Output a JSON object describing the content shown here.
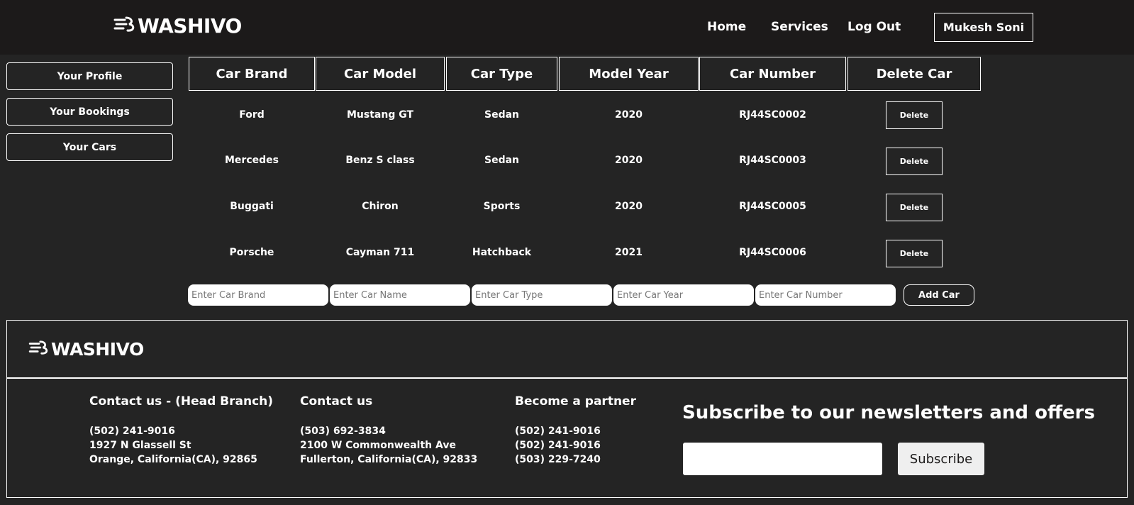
{
  "header": {
    "logo": "WASHIVO",
    "nav": [
      "Home",
      "Services",
      "Log Out"
    ],
    "user": "Mukesh Soni"
  },
  "sidebar": {
    "items": [
      "Your Profile",
      "Your Bookings",
      "Your Cars"
    ]
  },
  "table": {
    "columns": [
      "Car Brand",
      "Car Model",
      "Car Type",
      "Model Year",
      "Car Number",
      "Delete Car"
    ],
    "rows": [
      {
        "brand": "Ford",
        "model": "Mustang GT",
        "type": "Sedan",
        "year": "2020",
        "number": "RJ44SC0002",
        "action": "Delete"
      },
      {
        "brand": "Mercedes",
        "model": "Benz S class",
        "type": "Sedan",
        "year": "2020",
        "number": "RJ44SC0003",
        "action": "Delete"
      },
      {
        "brand": "Buggati",
        "model": "Chiron",
        "type": "Sports",
        "year": "2020",
        "number": "RJ44SC0005",
        "action": "Delete"
      },
      {
        "brand": "Porsche",
        "model": "Cayman 711",
        "type": "Hatchback",
        "year": "2021",
        "number": "RJ44SC0006",
        "action": "Delete"
      }
    ]
  },
  "add_form": {
    "placeholders": [
      "Enter Car Brand",
      "Enter Car Name",
      "Enter Car Type",
      "Enter Car Year",
      "Enter Car Number"
    ],
    "button": "Add Car"
  },
  "footer": {
    "logo": "WASHIVO",
    "columns": [
      {
        "heading": "Contact us - (Head Branch)",
        "lines": [
          "(502) 241-9016",
          "1927 N Glassell St",
          "Orange, California(CA), 92865"
        ]
      },
      {
        "heading": "Contact us",
        "lines": [
          "(503) 692-3834",
          "2100 W Commonwealth Ave",
          "Fullerton, California(CA), 92833"
        ]
      },
      {
        "heading": "Become a partner",
        "lines": [
          "(502) 241-9016",
          "(502) 241-9016",
          "(503) 229-7240"
        ]
      }
    ],
    "newsletter": {
      "title": "Subscribe to our newsletters and offers",
      "input_value": "",
      "button": "Subscribe"
    }
  },
  "colors": {
    "background": "#242424",
    "header": "#1c1a1a",
    "text": "#ffffff"
  }
}
